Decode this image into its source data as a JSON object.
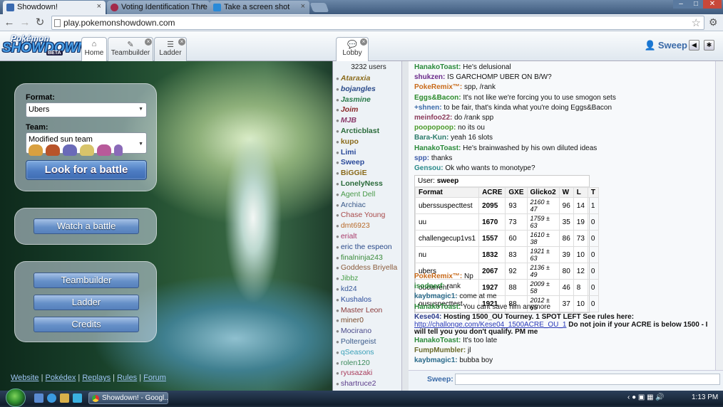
{
  "browser": {
    "tabs": [
      {
        "title": "Showdown!",
        "active": true
      },
      {
        "title": "Voting Identification Thre",
        "active": false
      },
      {
        "title": "Take a screen shot",
        "active": false
      }
    ],
    "url": "play.pokemonshowdown.com",
    "close_glyph": "×",
    "nav": {
      "back": "←",
      "forward": "→",
      "reload": "↻",
      "star": "☆",
      "wrench": "⚙"
    },
    "window": {
      "min": "–",
      "max": "□",
      "close": "✕"
    }
  },
  "header": {
    "logo": {
      "line1": "Pokémon",
      "line2": "SHOWDOWN",
      "badge": "BETA"
    },
    "tabs": [
      {
        "label": "Home",
        "icon": "⌂"
      },
      {
        "label": "Teambuilder",
        "icon": "✎"
      },
      {
        "label": "Ladder",
        "icon": "☰"
      },
      {
        "label": "Lobby",
        "icon": "💬"
      }
    ],
    "username": "Sweep",
    "user_icon": "👤",
    "sound_icon": "◀",
    "options_icon": "✱"
  },
  "home": {
    "format_label": "Format:",
    "format_value": "Ubers",
    "team_label": "Team:",
    "team_value": "Modified sun team",
    "team_sprites": [
      "#d9a040",
      "#b8542a",
      "#6a6ab8",
      "#d8c46a",
      "#b85a9a",
      "#8a6ab8"
    ],
    "battle_button": "Look for a battle",
    "watch_button": "Watch a battle",
    "teambuilder_button": "Teambuilder",
    "ladder_button": "Ladder",
    "credits_button": "Credits",
    "links": {
      "website": "Website",
      "pokedex": "Pokédex",
      "replays": "Replays",
      "rules": "Rules",
      "forum": "Forum",
      "sep": "|"
    }
  },
  "userlist": {
    "count": "3232 users",
    "users": [
      {
        "name": "Ataraxia",
        "color": "#8a6a1a",
        "style": "bi"
      },
      {
        "name": "bojangles",
        "color": "#2a4a8a",
        "style": "bi"
      },
      {
        "name": "Jasmine",
        "color": "#2a7a4a",
        "style": "bi"
      },
      {
        "name": "Joim",
        "color": "#8a2a2a",
        "style": "bi"
      },
      {
        "name": "MJB",
        "color": "#8a3a6a",
        "style": "bi"
      },
      {
        "name": "Arcticblast",
        "color": "#2a6a3a",
        "style": "b"
      },
      {
        "name": "kupo",
        "color": "#8a6a1a",
        "style": "b"
      },
      {
        "name": "Limi",
        "color": "#2a4a9a",
        "style": "b"
      },
      {
        "name": "Sweep",
        "color": "#2a4a9a",
        "style": "b"
      },
      {
        "name": "BiGGiE",
        "color": "#8a6a1a",
        "style": "b"
      },
      {
        "name": "LonelyNess",
        "color": "#2a6a3a",
        "style": "b"
      },
      {
        "name": "Agent Dell",
        "color": "#4a9a4a",
        "style": ""
      },
      {
        "name": "Archiac",
        "color": "#3a5a8a",
        "style": ""
      },
      {
        "name": "Chase Young",
        "color": "#a84a4a",
        "style": ""
      },
      {
        "name": "dmt6923",
        "color": "#b86a2a",
        "style": ""
      },
      {
        "name": "erialt",
        "color": "#a83a6a",
        "style": ""
      },
      {
        "name": "eric the espeon",
        "color": "#2a4a8a",
        "style": ""
      },
      {
        "name": "finalninja243",
        "color": "#3a8a3a",
        "style": ""
      },
      {
        "name": "Goddess Briyella",
        "color": "#8a5a3a",
        "style": ""
      },
      {
        "name": "Jibbz",
        "color": "#4aa04a",
        "style": ""
      },
      {
        "name": "kd24",
        "color": "#3a5a9a",
        "style": ""
      },
      {
        "name": "Kushalos",
        "color": "#2a4a9a",
        "style": ""
      },
      {
        "name": "Master Leon",
        "color": "#8a3a3a",
        "style": ""
      },
      {
        "name": "miner0",
        "color": "#7a4a2a",
        "style": ""
      },
      {
        "name": "Mocirano",
        "color": "#4a4a8a",
        "style": ""
      },
      {
        "name": "Poltergeist",
        "color": "#3a5a8a",
        "style": ""
      },
      {
        "name": "qSeasons",
        "color": "#3aa0b8",
        "style": ""
      },
      {
        "name": "rolen120",
        "color": "#3a8a5a",
        "style": ""
      },
      {
        "name": "ryusazaki",
        "color": "#a83a5a",
        "style": ""
      },
      {
        "name": "shartruce2",
        "color": "#5a3a8a",
        "style": ""
      }
    ],
    "rank_glyph": "●"
  },
  "chat": {
    "lines_before": [
      {
        "user": "HanakoToast:",
        "color": "#2a8a3a",
        "text": "He's delusional"
      },
      {
        "user": "shukzen:",
        "color": "#6a2a8a",
        "text": "IS GARCHOMP UBER ON B/W?"
      },
      {
        "user": "PokeRemix™:",
        "color": "#c86a1a",
        "text": "spp, /rank"
      },
      {
        "user": "Eggs&Bacon:",
        "color": "#2a8a2a",
        "text": "It's not like we're forcing you to use smogon sets"
      },
      {
        "user": "+shnen:",
        "color": "#3a6aa8",
        "text": "to be fair, that's kinda what you're doing Eggs&Bacon"
      },
      {
        "user": "meinfoo22:",
        "color": "#8a3a5a",
        "text": "do /rank spp"
      },
      {
        "user": "poopopoop:",
        "color": "#4a9a2a",
        "text": "no its ou"
      },
      {
        "user": "Bara-Kun:",
        "color": "#2a7a6a",
        "text": "yeah 16 slots"
      },
      {
        "user": "HanakoToast:",
        "color": "#2a8a3a",
        "text": "He's brainwashed by his own diluted ideas"
      },
      {
        "user": "spp:",
        "color": "#3a5aa8",
        "text": "thanks"
      },
      {
        "user": "Gensou:",
        "color": "#2a8a8a",
        "text": "Ok who wants to monotype?"
      }
    ],
    "rank_table": {
      "user_label": "User:",
      "user": "sweep",
      "headers": [
        "Format",
        "ACRE",
        "GXE",
        "Glicko2",
        "W",
        "L",
        "T"
      ],
      "rows": [
        [
          "uberssuspecttest",
          "2095",
          "93",
          "2160 ± 47",
          "96",
          "14",
          "1"
        ],
        [
          "uu",
          "1670",
          "73",
          "1759 ± 63",
          "35",
          "19",
          "0"
        ],
        [
          "challengecup1vs1",
          "1557",
          "60",
          "1610 ± 38",
          "86",
          "73",
          "0"
        ],
        [
          "nu",
          "1832",
          "83",
          "1921 ± 63",
          "39",
          "10",
          "0"
        ],
        [
          "ubers",
          "2067",
          "92",
          "2136 ± 49",
          "80",
          "12",
          "0"
        ],
        [
          "oucurrent",
          "1927",
          "88",
          "2009 ± 58",
          "46",
          "8",
          "0"
        ],
        [
          "oususpecttest",
          "1921",
          "88",
          "2012 ± 65",
          "37",
          "10",
          "0"
        ]
      ]
    },
    "lines_after": [
      {
        "user": "PokeRemix™:",
        "color": "#c86a1a",
        "text": "Np"
      },
      {
        "user": "isodnerf:",
        "color": "#2a8a3a",
        "text": "rank"
      },
      {
        "user": "kaybmagic1:",
        "color": "#2a6a8a",
        "text": "come at me"
      },
      {
        "user": "HanakoToast:",
        "color": "#2a8a3a",
        "text": "You cant save him anymore"
      }
    ],
    "kese": {
      "user": "Kese04:",
      "color": "#2a3a8a",
      "line1": "Hosting 1500_OU Tourney. 1 SPOT LEFT See rules here:",
      "link": "http://challonge.com/Kese04_1500ACRE_OU_1",
      "line2a": " Do not join if your ACRE is below 1500 - I",
      "line3": "will tell you you don't qualify. PM me"
    },
    "lines_end": [
      {
        "user": "HanakoToast:",
        "color": "#2a8a3a",
        "text": "It's too late"
      },
      {
        "user": "FumpMumbler:",
        "color": "#6a6a2a",
        "text": "jl"
      },
      {
        "user": "kaybmagic1:",
        "color": "#2a6a8a",
        "text": "bubba boy"
      }
    ],
    "input_name": "Sweep:",
    "input_value": ""
  },
  "taskbar": {
    "task": "Showdown! - Googl...",
    "time": "1:13 PM",
    "tray": "‹ ● ▣ ▦ 🔊"
  }
}
